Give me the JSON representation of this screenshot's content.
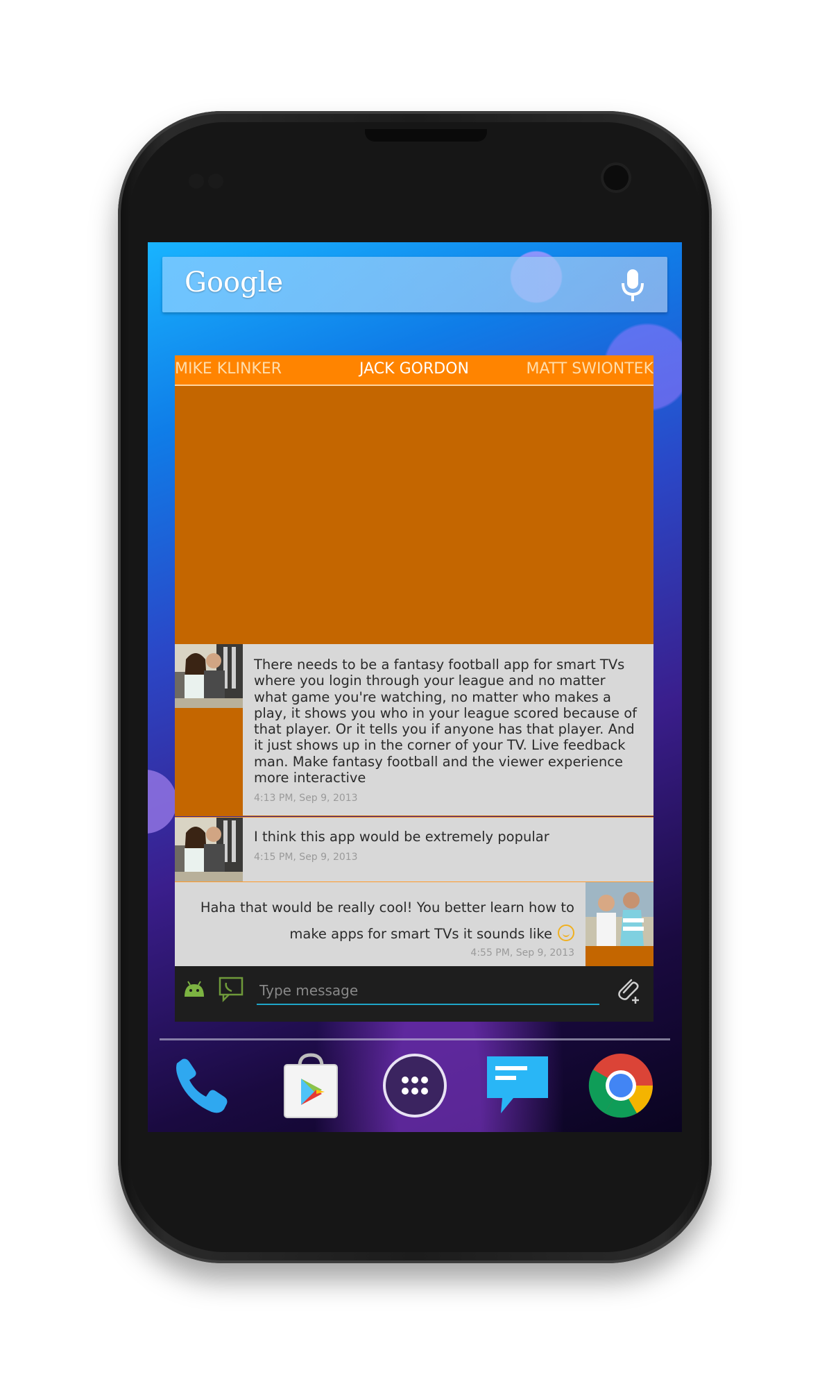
{
  "search": {
    "logo": "Google"
  },
  "widget": {
    "tabs": {
      "left": "MIKE KLINKER",
      "center": "JACK GORDON",
      "right": "MATT SWIONTEK"
    },
    "messages": [
      {
        "text": "There needs to be a fantasy football app for smart TVs where you login through your league and no matter what game you're watching, no matter who makes a play, it shows you who in your league scored because of that player. Or it tells you if anyone has that player. And it just shows up in the corner of your TV. Live feedback man. Make fantasy football and the viewer experience more interactive",
        "time": "4:13 PM, Sep 9, 2013"
      },
      {
        "text": "I think this app would be extremely popular",
        "time": "4:15 PM, Sep 9, 2013"
      },
      {
        "text": "Haha that would be really cool! You better learn how to make apps for smart TVs it sounds like",
        "time": "4:55 PM, Sep 9, 2013"
      }
    ],
    "input": {
      "placeholder": "Type message"
    }
  },
  "colors": {
    "tab_bar": "#ff8400",
    "content_orange": "#c46600",
    "bubble": "#d8d8d8",
    "input_accent": "#1fa6c8"
  },
  "dock": {
    "icons": [
      "phone-icon",
      "play-store-icon",
      "app-drawer-icon",
      "messaging-icon",
      "chrome-icon"
    ]
  }
}
